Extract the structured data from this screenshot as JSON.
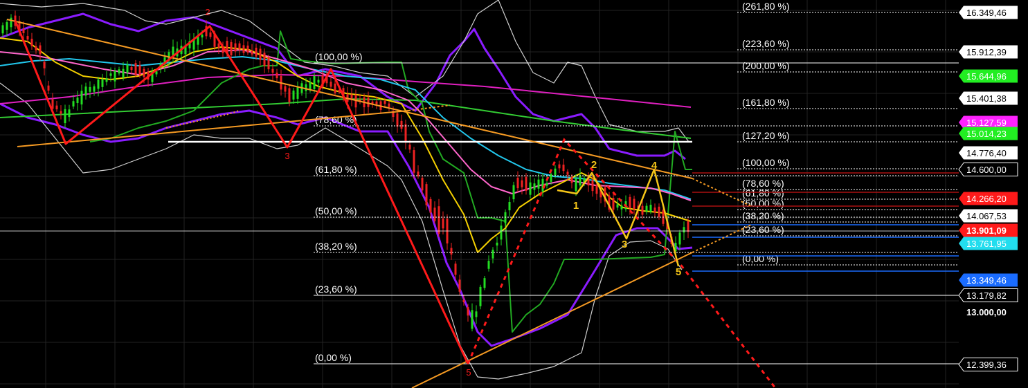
{
  "chart_data": {
    "type": "line",
    "instrument": "",
    "y_axis_side": "right",
    "colors": {
      "background": "#000000",
      "grid": "#222222",
      "candle_up": "#22dd22",
      "candle_down": "#ee2222",
      "wave_main": "#ff1a1a",
      "wave_minor": "#f5c518",
      "trendline": "#f59a23",
      "bollinger_outer": "#8a1cff",
      "bollinger_inner": "#d0d0d0",
      "ma_pink": "#ff66cc",
      "ma_cyan": "#22c8ee",
      "ma_yellow": "#f5d000",
      "ma_green": "#33cc33",
      "ma_magenta": "#e020c0"
    },
    "price_axis": {
      "ticks": [
        "13.000,00"
      ],
      "tags": [
        {
          "label": "16.349,46",
          "value": 16349.46,
          "bg": "#ffffff",
          "fg": "#000000"
        },
        {
          "label": "15.912,39",
          "value": 15912.39,
          "bg": "#ffffff",
          "fg": "#000000"
        },
        {
          "label": "15.644,96",
          "value": 15644.96,
          "bg": "#22ee22",
          "fg": "#ffffff"
        },
        {
          "label": "15.401,38",
          "value": 15401.38,
          "bg": "#ffffff",
          "fg": "#000000"
        },
        {
          "label": "15.127,59",
          "value": 15127.59,
          "bg": "#ff22ff",
          "fg": "#ffffff"
        },
        {
          "label": "15.014,23",
          "value": 15014.23,
          "bg": "#22ee22",
          "fg": "#ffffff"
        },
        {
          "label": "14.776,40",
          "value": 14776.4,
          "bg": "#ffffff",
          "fg": "#000000"
        },
        {
          "label": "14.600,00",
          "value": 14600.0,
          "bg": "#000000",
          "fg": "#ffffff"
        },
        {
          "label": "14.266,20",
          "value": 14266.2,
          "bg": "#ff1a1a",
          "fg": "#ffffff"
        },
        {
          "label": "14.067,53",
          "value": 14067.53,
          "bg": "#ffffff",
          "fg": "#000000"
        },
        {
          "label": "13.901,09",
          "value": 13901.09,
          "bg": "#ff1a1a",
          "fg": "#ffffff",
          "bold": true
        },
        {
          "label": "13.761,95",
          "value": 13761.95,
          "bg": "#22ddee",
          "fg": "#ffffff"
        },
        {
          "label": "13.349,46",
          "value": 13349.46,
          "bg": "#1a6cff",
          "fg": "#ffffff"
        },
        {
          "label": "13.179,82",
          "value": 13179.82,
          "bg": "#000000",
          "fg": "#ffffff"
        },
        {
          "label": "12.399,36",
          "value": 12399.36,
          "bg": "#000000",
          "fg": "#ffffff"
        }
      ]
    },
    "fibonacci_large": {
      "levels": [
        {
          "label": "(100,00 %)"
        },
        {
          "label": "(78,60 %)"
        },
        {
          "label": "(61,80 %)"
        },
        {
          "label": "(50,00 %)"
        },
        {
          "label": "(38,20 %)"
        },
        {
          "label": "(23,60 %)"
        },
        {
          "label": "(0,00 %)"
        }
      ]
    },
    "fibonacci_extension": {
      "levels": [
        {
          "label": "(261,80 %)"
        },
        {
          "label": "(223,60 %)"
        },
        {
          "label": "(200,00 %)"
        },
        {
          "label": "(161,80 %)"
        },
        {
          "label": "(127,20 %)"
        },
        {
          "label": "(100,00 %)"
        },
        {
          "label": "(78,60 %)"
        },
        {
          "label": "(61,80 %)"
        },
        {
          "label": "(50,00 %)"
        },
        {
          "label": "(38,20 %)"
        },
        {
          "label": "(23,60 %)"
        },
        {
          "label": "(0,00 %)"
        }
      ]
    },
    "wave_labels": {
      "main": [
        "2",
        "3",
        "5"
      ],
      "minor": [
        "1",
        "2",
        "3",
        "4",
        "5"
      ]
    }
  }
}
